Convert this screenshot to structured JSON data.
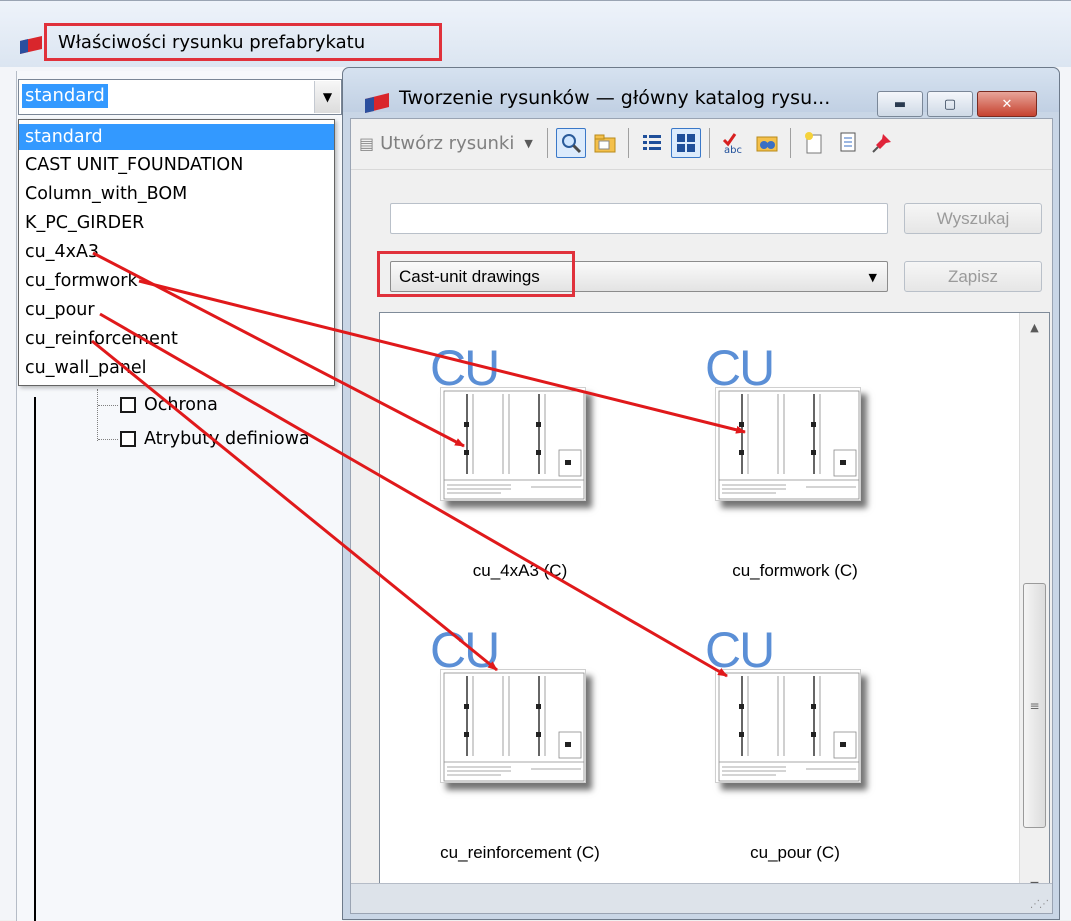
{
  "back_window": {
    "title": "Właściwości rysunku prefabrykatu",
    "profile_combo": {
      "selected": "standard",
      "options": [
        "standard",
        "CAST UNIT_FOUNDATION",
        "Column_with_BOM",
        "K_PC_GIRDER",
        "cu_4xA3",
        "cu_formwork",
        "cu_pour",
        "cu_reinforcement",
        "cu_wall_panel"
      ]
    },
    "tree_items": [
      "Ochrona",
      "Atrybuty definiowa"
    ]
  },
  "front_dialog": {
    "title": "Tworzenie rysunków — główny katalog rysu...",
    "toolbar": {
      "create_label": "Utwórz rysunki",
      "icons": [
        "search-icon",
        "folder-icon",
        "list-view-icon",
        "thumbnail-view-icon",
        "spellcheck-icon",
        "folder-binoculars-icon",
        "new-document-icon",
        "document-icon",
        "pin-icon"
      ]
    },
    "search": {
      "placeholder": "",
      "button_label": "Wyszukaj"
    },
    "catalog": {
      "selected": "Cast-unit drawings",
      "save_label": "Zapisz"
    },
    "thumbnails": [
      {
        "badge": "CU",
        "label": "cu_4xA3 (C)"
      },
      {
        "badge": "CU",
        "label": "cu_formwork (C)"
      },
      {
        "badge": "CU",
        "label": "cu_reinforcement (C)"
      },
      {
        "badge": "CU",
        "label": "cu_pour (C)"
      }
    ],
    "scrollbar_grip": "≡"
  },
  "colors": {
    "highlight": "#e0313b",
    "arrow": "#e0191b",
    "selection": "#3399ff",
    "cu_badge": "#5b8fd6"
  }
}
